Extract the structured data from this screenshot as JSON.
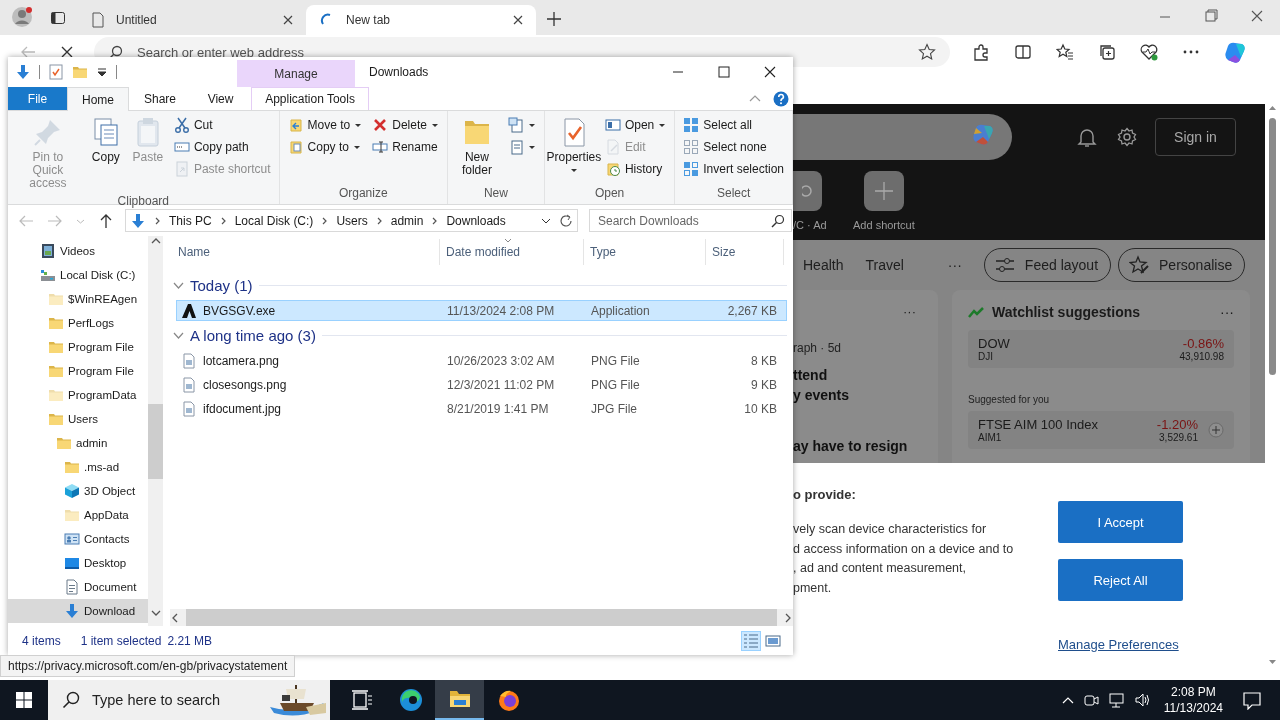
{
  "browser": {
    "tabs": [
      {
        "title": "Untitled",
        "selected": false,
        "loading": false
      },
      {
        "title": "New tab",
        "selected": true,
        "loading": true
      }
    ],
    "address": {
      "placeholder": "Search or enter web address"
    },
    "page": {
      "sign_in": "Sign in",
      "shortcuts": [
        {
          "label": "/C · Ad",
          "kind": "site"
        },
        {
          "label": "Add shortcut",
          "kind": "add"
        }
      ],
      "feed_nav": [
        "Health",
        "Travel"
      ],
      "feed_more": "···",
      "feed_buttons": [
        {
          "label": "Feed layout",
          "kind": "layout"
        },
        {
          "label": "Personalise",
          "kind": "personalise"
        }
      ],
      "story": {
        "menu": "···",
        "source": "raph · 5d",
        "headline": [
          "ttend",
          "y events"
        ],
        "next_headline": "ay have to resign"
      },
      "watchlist": {
        "title": "Watchlist suggestions",
        "menu": "···",
        "quotes": [
          {
            "name": "DOW",
            "symbol": "DJI",
            "change": "-0.86%",
            "price": "43,910.98"
          }
        ],
        "suggested_label": "Suggested for you",
        "suggested": [
          {
            "name": "FTSE AIM 100 Index",
            "symbol": "AIM1",
            "change": "-1.20%",
            "price": "3,529.61"
          }
        ]
      },
      "consent": {
        "heading": "o provide:",
        "lines": [
          "vely scan device characteristics for",
          "d access information on a device and to",
          ", ad and content measurement,",
          "pment."
        ],
        "buttons": [
          "I Accept",
          "Reject All"
        ],
        "link": "Manage Preferences"
      }
    },
    "status_url": "https://privacy.microsoft.com/en-gb/privacystatement"
  },
  "explorer": {
    "context_tab": "Manage",
    "title": "Downloads",
    "ribbon_tabs": [
      {
        "label": "File",
        "kind": "file",
        "selected": false
      },
      {
        "label": "Home",
        "kind": "tab",
        "selected": true
      },
      {
        "label": "Share",
        "kind": "tab",
        "selected": false
      },
      {
        "label": "View",
        "kind": "tab",
        "selected": false
      },
      {
        "label": "Application Tools",
        "kind": "context",
        "selected": false
      }
    ],
    "ribbon": [
      {
        "label": "Clipboard",
        "items": [
          {
            "kind": "large",
            "label": "Pin to Quick access",
            "disabled": true,
            "dropdown": false
          },
          {
            "kind": "large",
            "label": "Copy",
            "disabled": false,
            "dropdown": false
          },
          {
            "kind": "large",
            "label": "Paste",
            "disabled": true,
            "dropdown": false
          },
          {
            "kind": "column",
            "commands": [
              {
                "label": "Cut",
                "disabled": false,
                "dropdown": false
              },
              {
                "label": "Copy path",
                "disabled": false,
                "dropdown": false
              },
              {
                "label": "Paste shortcut",
                "disabled": true,
                "dropdown": false
              }
            ]
          }
        ]
      },
      {
        "label": "Organize",
        "items": [
          {
            "kind": "column",
            "commands": [
              {
                "label": "Move to",
                "disabled": false,
                "dropdown": true
              },
              {
                "label": "Copy to",
                "disabled": false,
                "dropdown": true
              }
            ]
          },
          {
            "kind": "column",
            "commands": [
              {
                "label": "Delete",
                "disabled": false,
                "dropdown": true
              },
              {
                "label": "Rename",
                "disabled": false,
                "dropdown": false
              }
            ]
          }
        ]
      },
      {
        "label": "New",
        "items": [
          {
            "kind": "large",
            "label": "New folder",
            "disabled": false,
            "dropdown": false
          },
          {
            "kind": "column",
            "commands": [
              {
                "disabled": false,
                "dropdown": true
              },
              {
                "disabled": false,
                "dropdown": true
              }
            ]
          }
        ]
      },
      {
        "label": "Open",
        "items": [
          {
            "kind": "large",
            "label": "Properties",
            "disabled": false,
            "dropdown": true
          },
          {
            "kind": "column",
            "commands": [
              {
                "label": "Open",
                "disabled": false,
                "dropdown": true
              },
              {
                "label": "Edit",
                "disabled": true,
                "dropdown": false
              },
              {
                "label": "History",
                "disabled": false,
                "dropdown": false
              }
            ]
          }
        ]
      },
      {
        "label": "Select",
        "items": [
          {
            "kind": "column",
            "commands": [
              {
                "label": "Select all",
                "disabled": false,
                "dropdown": false
              },
              {
                "label": "Select none",
                "disabled": false,
                "dropdown": false
              },
              {
                "label": "Invert selection",
                "disabled": false,
                "dropdown": false
              }
            ]
          }
        ]
      }
    ],
    "address": {
      "path": [
        "This PC",
        "Local Disk (C:)",
        "Users",
        "admin",
        "Downloads"
      ],
      "search_placeholder": "Search Downloads"
    },
    "nav": [
      {
        "label": "Videos",
        "kind": "video",
        "hidden": false,
        "selected": false
      },
      {
        "label": "Local Disk (C:)",
        "kind": "drive",
        "hidden": false,
        "selected": false,
        "children": [
          {
            "label": "$WinREAgen",
            "kind": "folder",
            "hidden": true,
            "selected": false
          },
          {
            "label": "PerfLogs",
            "kind": "folder",
            "hidden": false,
            "selected": false
          },
          {
            "label": "Program File",
            "kind": "folder",
            "hidden": false,
            "selected": false
          },
          {
            "label": "Program File",
            "kind": "folder",
            "hidden": false,
            "selected": false
          },
          {
            "label": "ProgramData",
            "kind": "folder",
            "hidden": true,
            "selected": false
          },
          {
            "label": "Users",
            "kind": "folder",
            "hidden": false,
            "selected": false,
            "children": [
              {
                "label": "admin",
                "kind": "folder",
                "hidden": false,
                "selected": false,
                "children": [
                  {
                    "label": ".ms-ad",
                    "kind": "folder",
                    "hidden": false,
                    "selected": false
                  },
                  {
                    "label": "3D Object",
                    "kind": "cube",
                    "hidden": false,
                    "selected": false
                  },
                  {
                    "label": "AppData",
                    "kind": "folder",
                    "hidden": true,
                    "selected": false
                  },
                  {
                    "label": "Contacts",
                    "kind": "contacts",
                    "hidden": false,
                    "selected": false
                  },
                  {
                    "label": "Desktop",
                    "kind": "desktop",
                    "hidden": false,
                    "selected": false
                  },
                  {
                    "label": "Document",
                    "kind": "document",
                    "hidden": false,
                    "selected": false
                  },
                  {
                    "label": "Download",
                    "kind": "download",
                    "hidden": false,
                    "selected": true
                  }
                ]
              }
            ]
          }
        ]
      }
    ],
    "columns": [
      {
        "label": "Name",
        "sorted": false
      },
      {
        "label": "Date modified",
        "sorted": true
      },
      {
        "label": "Type",
        "sorted": false
      },
      {
        "label": "Size",
        "sorted": false
      }
    ],
    "groups": [
      {
        "label": "Today (1)",
        "expanded": true,
        "files": [
          {
            "name": "BVGSGV.exe",
            "date": "11/13/2024 2:08 PM",
            "type": "Application",
            "size": "2,267 KB",
            "kind": "app",
            "selected": true
          }
        ]
      },
      {
        "label": "A long time ago (3)",
        "expanded": true,
        "files": [
          {
            "name": "lotcamera.png",
            "date": "10/26/2023 3:02 AM",
            "type": "PNG File",
            "size": "8 KB",
            "kind": "image",
            "selected": false
          },
          {
            "name": "closesongs.png",
            "date": "12/3/2021 11:02 PM",
            "type": "PNG File",
            "size": "9 KB",
            "kind": "image",
            "selected": false
          },
          {
            "name": "ifdocument.jpg",
            "date": "8/21/2019 1:41 PM",
            "type": "JPG File",
            "size": "10 KB",
            "kind": "image",
            "selected": false
          }
        ]
      }
    ],
    "status": {
      "count": "4 items",
      "selection": "1 item selected",
      "size": "2.21 MB"
    },
    "views": [
      {
        "kind": "details",
        "selected": true
      },
      {
        "kind": "thumbnails",
        "selected": false
      }
    ]
  },
  "taskbar": {
    "search_placeholder": "Type here to search",
    "apps": [
      {
        "kind": "taskview",
        "selected": false
      },
      {
        "kind": "edge",
        "selected": false
      },
      {
        "kind": "explorer",
        "selected": true
      },
      {
        "kind": "firefox",
        "selected": false
      }
    ],
    "time": "2:08 PM",
    "date": "11/13/2024"
  }
}
